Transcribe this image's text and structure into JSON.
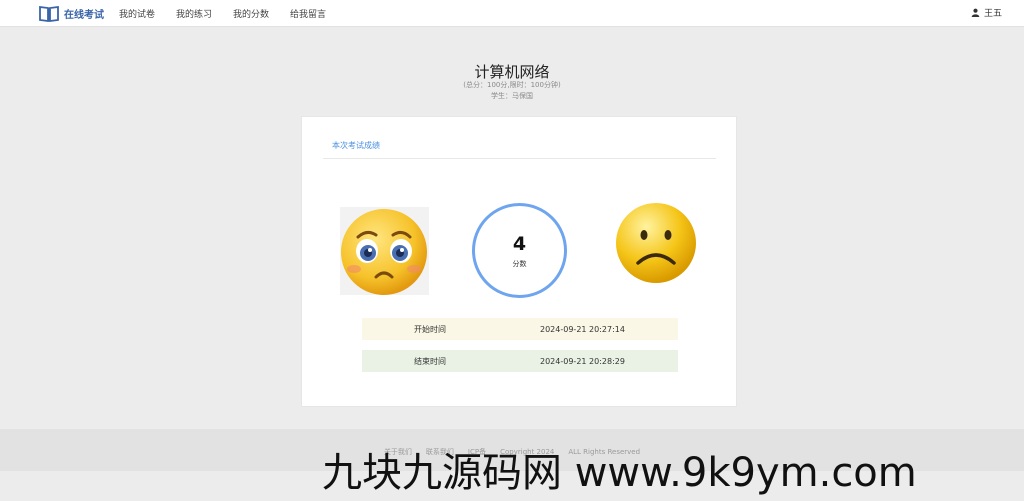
{
  "navbar": {
    "brand": "在线考试",
    "brand_icon": "open-book-icon",
    "links": [
      "我的试卷",
      "我的练习",
      "我的分数",
      "给我留言"
    ],
    "user_name": "王五",
    "user_icon": "user-icon"
  },
  "exam": {
    "title": "计算机网络",
    "meta": "(总分：100分,限时：100分钟)",
    "student": "学生：马保国"
  },
  "result": {
    "section_title": "本次考试成绩",
    "score": "4",
    "score_label": "分数",
    "start_label": "开始时间",
    "start_time": "2024-09-21 20:27:14",
    "end_label": "结束时间",
    "end_time": "2024-09-21 20:28:29",
    "left_emoji": "pleading-face-icon",
    "right_emoji": "frowning-face-icon"
  },
  "footer": {
    "text": "关于我们　　联系我们　　ICP备　　Copyright 2024　　ALL Rights Reserved"
  },
  "watermark": {
    "text": "九块九源码网 www.9k9ym.com"
  },
  "colors": {
    "brand": "#3a64a8",
    "accent": "#4a90e2",
    "ring": "#6ea5ee",
    "start_row": "#faf7e6",
    "end_row": "#e9f2e4",
    "background": "#ececec"
  }
}
